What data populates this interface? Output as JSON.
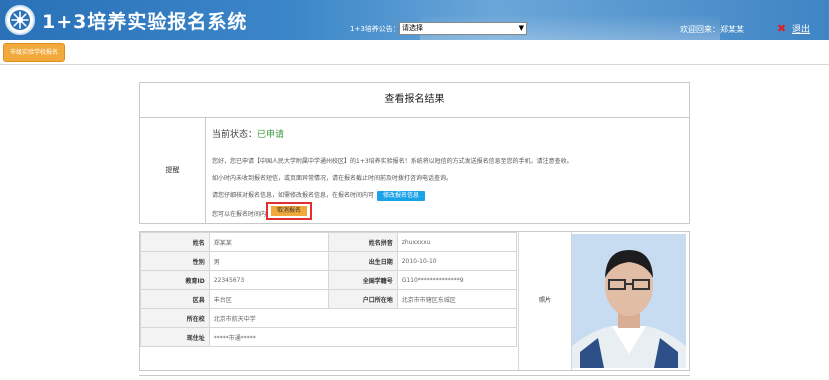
{
  "header": {
    "title": "1+3培养实验报名系统",
    "notice_label": "1+3培养公告：",
    "notice_select_value": "请选择",
    "welcome": "欢迎回来：郑某某",
    "logout": "退出",
    "colors": {
      "bg": "#3b86c8",
      "logout_icon": "#d9242a"
    }
  },
  "tabs": [
    {
      "label": "市级实验学校报名"
    }
  ],
  "result": {
    "title": "查看报名结果",
    "remind_label": "提醒",
    "status_label": "当前状态：",
    "status_value": "已申请",
    "line1": "您好，您已申请【中国人民大学附属中学通州校区】的1+3培养实验报名！系统将以短信的方式发送报名信息至您的手机，请注意查收。",
    "line2": "如小时内未收到报名短信，或页面异常情况，请在报名截止时间前及时拨打咨询电话查询。",
    "line3": "请您仔细核对报名信息，如需修改报名信息，在报名时间内可",
    "edit_button": "修改报名信息",
    "line4": "您可以在报名时间内",
    "cancel_button": "取消报名"
  },
  "info": {
    "rows": [
      {
        "l1": "姓名",
        "v1": "郑某某",
        "l2": "姓名拼音",
        "v2": "zhuxxxxu"
      },
      {
        "l1": "性别",
        "v1": "男",
        "l2": "出生日期",
        "v2": "2010-10-10"
      },
      {
        "l1": "教育ID",
        "v1": "22345673",
        "l2": "全国学籍号",
        "v2": "G110**************9"
      },
      {
        "l1": "区县",
        "v1": "丰台区",
        "l2": "户口所在地",
        "v2": "北京市市辖区东城区"
      }
    ],
    "school_label": "所在校",
    "school_value": "北京市航天中学",
    "address_label": "现住址",
    "address_value": "*****市通*****",
    "photo_label": "照片"
  }
}
